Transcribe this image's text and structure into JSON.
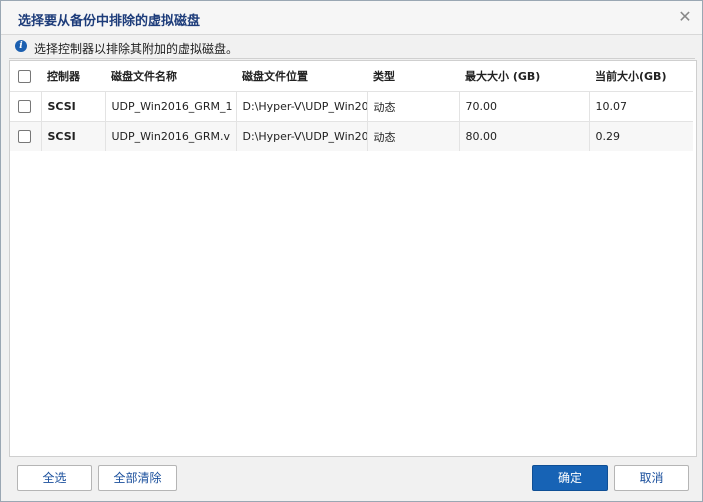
{
  "dialog": {
    "title": "选择要从备份中排除的虚拟磁盘",
    "close_glyph": "✕",
    "info_text": "选择控制器以排除其附加的虚拟磁盘。",
    "info_glyph": "i"
  },
  "table": {
    "columns": [
      "控制器",
      "磁盘文件名称",
      "磁盘文件位置",
      "类型",
      "最大大小 (GB)",
      "当前大小(GB)"
    ],
    "rows": [
      {
        "controller": "SCSI",
        "file_name": "UDP_Win2016_GRM_1",
        "file_location": "D:\\Hyper-V\\UDP_Win20",
        "type": "动态",
        "max_size": "70.00",
        "current_size": "10.07"
      },
      {
        "controller": "SCSI",
        "file_name": "UDP_Win2016_GRM.v",
        "file_location": "D:\\Hyper-V\\UDP_Win20",
        "type": "动态",
        "max_size": "80.00",
        "current_size": "0.29"
      }
    ]
  },
  "buttons": {
    "select_all": "全选",
    "clear_all": "全部清除",
    "ok": "确定",
    "cancel": "取消"
  },
  "colors": {
    "title": "#1d3c7a",
    "primary_button": "#1763b5",
    "info_icon": "#1b5fb0"
  }
}
